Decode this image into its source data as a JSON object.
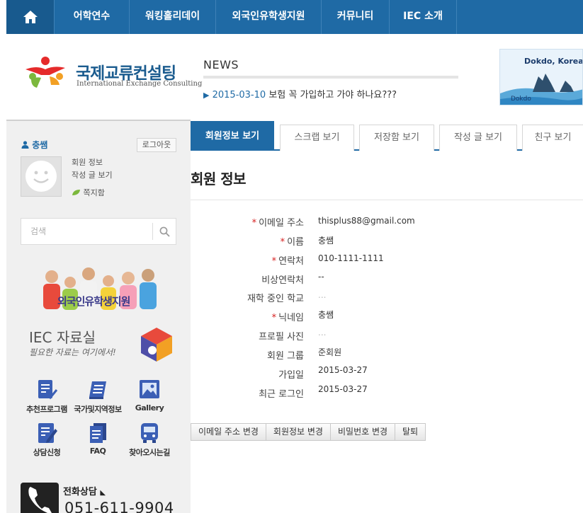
{
  "nav": {
    "home_icon": "home-icon",
    "items": [
      {
        "label": "어학연수"
      },
      {
        "label": "워킹홀리데이"
      },
      {
        "label": "외국인유학생지원"
      },
      {
        "label": "커뮤니티"
      },
      {
        "label": "IEC 소개"
      }
    ]
  },
  "header": {
    "logo_ko": "국제교류컨설팅",
    "logo_en": "International Exchange Consulting",
    "news_title": "NEWS",
    "news_date": "2015-03-10",
    "news_text": "보험 꼭 가입하고 가야 하나요???",
    "banner_title": "Dokdo, Korea's",
    "banner_sub": "Dokdo"
  },
  "sidebar": {
    "user_name": "충쌤",
    "logout_label": "로그아웃",
    "links": [
      {
        "label": "회원 정보"
      },
      {
        "label": "작성 글 보기"
      },
      {
        "label": "쪽지함"
      }
    ],
    "search_placeholder": "검색",
    "students_banner": "외국인유학생지원",
    "resource_title": "IEC 자료실",
    "resource_sub": "필요한 자료는 여기에서!",
    "quick_links": [
      {
        "label": "추천프로그램",
        "icon": "document-check-icon"
      },
      {
        "label": "국가및지역정보",
        "icon": "book-icon"
      },
      {
        "label": "Gallery",
        "icon": "image-icon"
      },
      {
        "label": "상담신청",
        "icon": "edit-icon"
      },
      {
        "label": "FAQ",
        "icon": "documents-icon"
      },
      {
        "label": "찾아오시는길",
        "icon": "bus-icon"
      }
    ],
    "phone_title": "전화상담",
    "phone_number": "051-611-9904"
  },
  "tabs": [
    {
      "label": "회원정보 보기",
      "active": true
    },
    {
      "label": "스크랩 보기"
    },
    {
      "label": "저장함 보기"
    },
    {
      "label": "작성 글 보기"
    },
    {
      "label": "친구 보기"
    }
  ],
  "page_title": "회원 정보",
  "fields": [
    {
      "label": "이메일 주소",
      "required": true,
      "value": "thisplus88@gmail.com"
    },
    {
      "label": "이름",
      "required": true,
      "value": "충쌤"
    },
    {
      "label": "연락처",
      "required": true,
      "value": "010-1111-1111"
    },
    {
      "label": "비상연락처",
      "required": false,
      "value": "--"
    },
    {
      "label": "재학 중인 학교",
      "required": false,
      "value": "..."
    },
    {
      "label": "닉네임",
      "required": true,
      "value": "충쌤"
    },
    {
      "label": "프로필 사진",
      "required": false,
      "value": "..."
    },
    {
      "label": "회원 그룹",
      "required": false,
      "value": "준회원"
    },
    {
      "label": "가입일",
      "required": false,
      "value": "2015-03-27"
    },
    {
      "label": "최근 로그인",
      "required": false,
      "value": "2015-03-27"
    }
  ],
  "actions": [
    {
      "label": "이메일 주소 변경"
    },
    {
      "label": "회원정보 변경"
    },
    {
      "label": "비밀번호 변경"
    },
    {
      "label": "탈퇴"
    }
  ],
  "colors": {
    "primary": "#1f6aa5",
    "required": "#d62020",
    "sidebar_bg": "#f0f0f0"
  }
}
